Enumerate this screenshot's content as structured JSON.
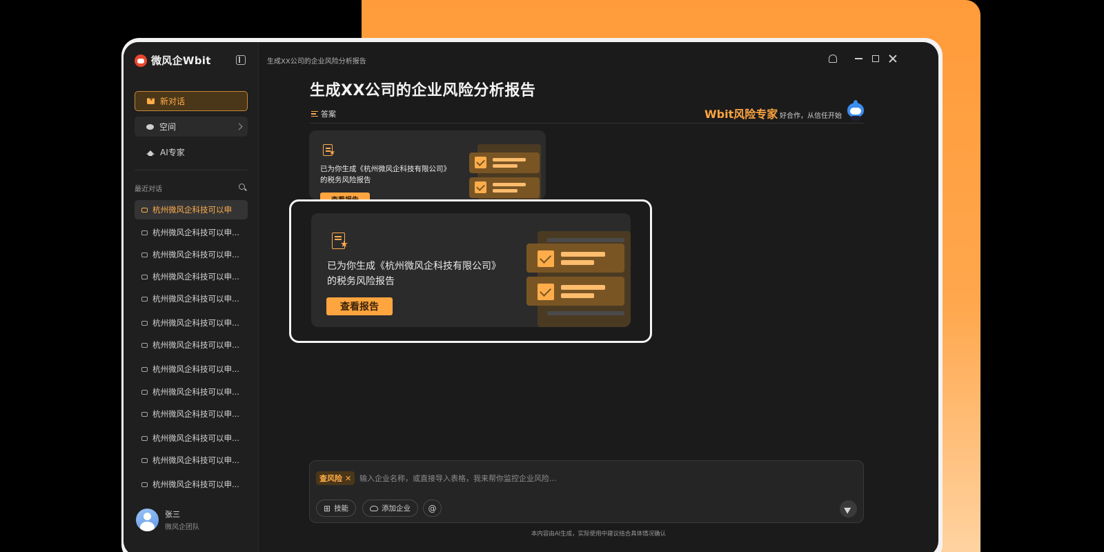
{
  "app": {
    "name": "微风企Wbit",
    "breadcrumb": "生成XX公司的企业风险分析报告"
  },
  "sidebar": {
    "new_chat": "新对话",
    "space": "空间",
    "ai_expert": "AI专家",
    "recent_label": "最近对话",
    "recent_items": [
      "杭州微风企科技可以申",
      "杭州微风企科技可以申...",
      "杭州微风企科技可以申...",
      "杭州微风企科技可以申...",
      "杭州微风企科技可以申...",
      "杭州微风企科技可以申...",
      "杭州微风企科技可以申...",
      "杭州微风企科技可以申...",
      "杭州微风企科技可以申...",
      "杭州微风企科技可以申...",
      "杭州微风企科技可以申...",
      "杭州微风企科技可以申...",
      "杭州微风企科技可以申..."
    ],
    "active_index": 0,
    "user": {
      "name": "张三",
      "team": "微风企团队"
    }
  },
  "main": {
    "title": "生成XX公司的企业风险分析报告",
    "answer_tab": "答案",
    "expert_name": "Wbit风险专家",
    "expert_slogan": "好合作，从信任开始",
    "report_card": {
      "line1": "已为你生成《杭州微风企科技有限公司》",
      "line2": "的税务风险报告",
      "button": "查看报告"
    }
  },
  "composer": {
    "tag": "查风险",
    "placeholder": "输入企业名称，或直接导入表格，我来帮你监控企业风险...",
    "skills": "技能",
    "add_company": "添加企业",
    "at": "@"
  },
  "footer": {
    "disclaimer": "本内容由AI生成，实际使用中建议结合具体情况确认"
  },
  "colors": {
    "accent": "#ffa53f",
    "background": "#1b1b1c",
    "card": "#2b2b2c"
  }
}
